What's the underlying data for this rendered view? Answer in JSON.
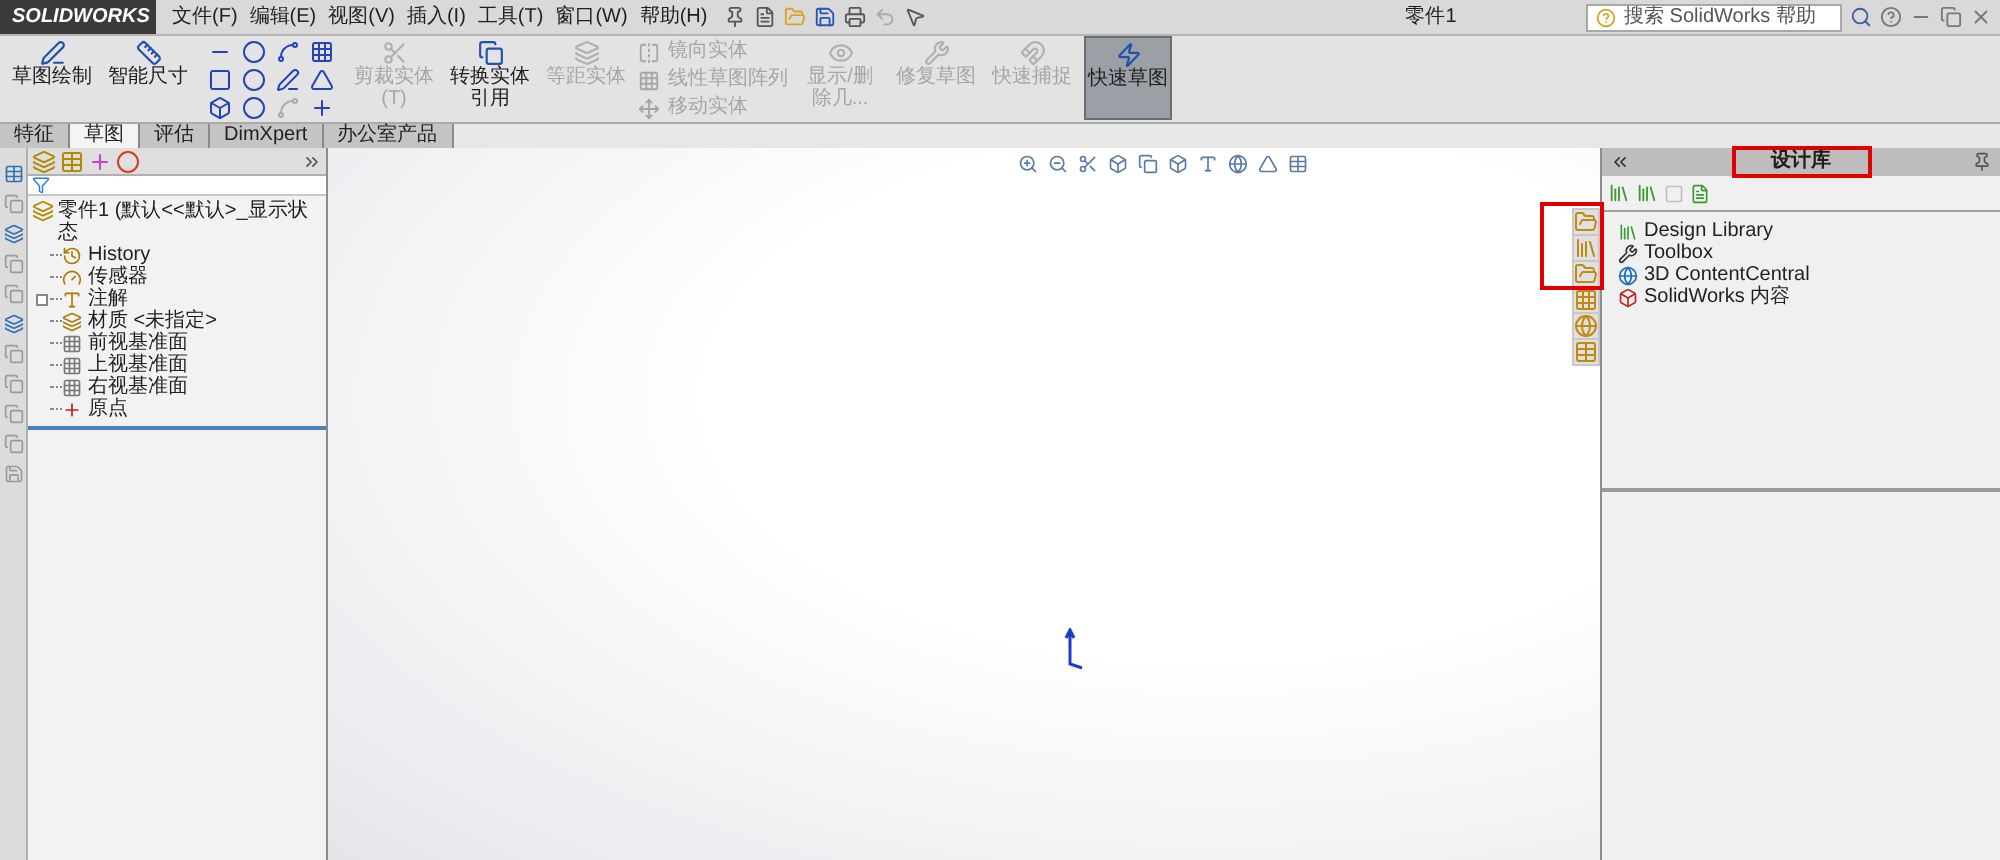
{
  "title_bar": {
    "logo": "SOLIDWORKS",
    "menus": [
      "文件(F)",
      "编辑(E)",
      "视图(V)",
      "插入(I)",
      "工具(T)",
      "窗口(W)",
      "帮助(H)"
    ],
    "document_title": "零件1",
    "search": {
      "placeholder": "搜索 SolidWorks 帮助"
    }
  },
  "ribbon": {
    "items": [
      {
        "kind": "large",
        "label": "草图绘制",
        "disabled": false,
        "selected": false
      },
      {
        "kind": "large",
        "label": "智能尺寸",
        "disabled": false,
        "selected": false
      },
      {
        "kind": "sketch_tools"
      },
      {
        "kind": "large",
        "label": "剪裁实体(T)",
        "disabled": true,
        "selected": false
      },
      {
        "kind": "large",
        "label": "转换实体引用",
        "disabled": false,
        "selected": false
      },
      {
        "kind": "large",
        "label": "等距实体",
        "disabled": true,
        "selected": false
      },
      {
        "kind": "small_group",
        "entries": [
          {
            "label": "镜向实体",
            "disabled": true
          },
          {
            "label": "线性草图阵列",
            "disabled": true
          },
          {
            "label": "移动实体",
            "disabled": true
          }
        ]
      },
      {
        "kind": "large",
        "label": "显示/删除几...",
        "disabled": true,
        "selected": false
      },
      {
        "kind": "large",
        "label": "修复草图",
        "disabled": true,
        "selected": false
      },
      {
        "kind": "large",
        "label": "快速捕捉",
        "disabled": true,
        "selected": false
      },
      {
        "kind": "large",
        "label": "快速草图",
        "disabled": false,
        "selected": true
      }
    ]
  },
  "tabs": [
    {
      "label": "特征",
      "selected": false
    },
    {
      "label": "草图",
      "selected": true
    },
    {
      "label": "评估",
      "selected": false
    },
    {
      "label": "DimXpert",
      "selected": false
    },
    {
      "label": "办公室产品",
      "selected": false
    }
  ],
  "feature_tree": {
    "root": {
      "label": "零件1 (默认<<默认>_显示状态",
      "children": [
        {
          "label": "History",
          "expandable": false
        },
        {
          "label": "传感器",
          "expandable": false
        },
        {
          "label": "注解",
          "expandable": true
        },
        {
          "label": "材质 <未指定>",
          "expandable": false
        },
        {
          "label": "前视基准面",
          "expandable": false
        },
        {
          "label": "上视基准面",
          "expandable": false
        },
        {
          "label": "右视基准面",
          "expandable": false
        },
        {
          "label": "原点",
          "expandable": false
        }
      ]
    }
  },
  "task_pane": {
    "title": "设计库",
    "items": [
      {
        "label": "Design Library"
      },
      {
        "label": "Toolbox"
      },
      {
        "label": "3D ContentCentral"
      },
      {
        "label": "SolidWorks 内容"
      }
    ]
  }
}
